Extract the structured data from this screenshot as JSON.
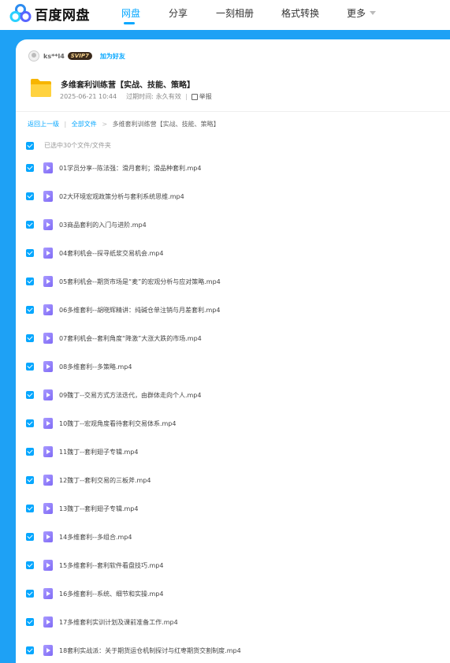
{
  "app": {
    "logo_text": "百度网盘",
    "accent_color": "#06a7ff"
  },
  "nav": {
    "items": [
      {
        "label": "网盘",
        "active": true
      },
      {
        "label": "分享",
        "active": false
      },
      {
        "label": "一刻相册",
        "active": false
      },
      {
        "label": "格式转换",
        "active": false
      },
      {
        "label": "更多",
        "active": false
      }
    ]
  },
  "share": {
    "user": "ks**l4",
    "vip_badge": "SVIP7",
    "add_friend": "加为好友"
  },
  "folder": {
    "title": "多维套利训练营【实战、技能、策略】",
    "date": "2025-06-21 10:44",
    "expire_label": "过期时间:",
    "expire_value": "永久有效",
    "report": "举报"
  },
  "breadcrumb": {
    "back": "返回上一级",
    "all_files": "全部文件",
    "current": "多维套利训练营【实战、技能、策略】"
  },
  "selection": {
    "text": "已选中30个文件/文件夹"
  },
  "files": [
    "01学员分享--陈法强：滑月套利；滑品种套利.mp4",
    "02大环境宏观政策分析与套利系统思维.mp4",
    "03商品套利的入门与进阶.mp4",
    "04套利机会--探寻纸浆交易机会.mp4",
    "05套利机会--期货市场是“麦”的宏观分析与应对策略.mp4",
    "06多维套利--胡晓辉精讲：纯碱仓单注销与月差套利.mp4",
    "07套利机会--套利角度“降激”大涨大跌的市场.mp4",
    "08多维套利--多策略.mp4",
    "09魏丁--交易方式方法迭代，由群体走向个人.mp4",
    "10魏丁--宏观角度看待套利交易体系.mp4",
    "11魏丁--套利翅子专辑.mp4",
    "12魏丁--套利交易的三板斧.mp4",
    "13魏丁--套利翅子专辑.mp4",
    "14多维套利--多组合.mp4",
    "15多维套利--套利软件看盘技巧.mp4",
    "16多维套利--系统、细节和实操.mp4",
    "17多维套利实训计划及课前准备工作.mp4",
    "18套利实战派：关于期货运仓机制探讨与红枣期货交割制度.mp4"
  ]
}
